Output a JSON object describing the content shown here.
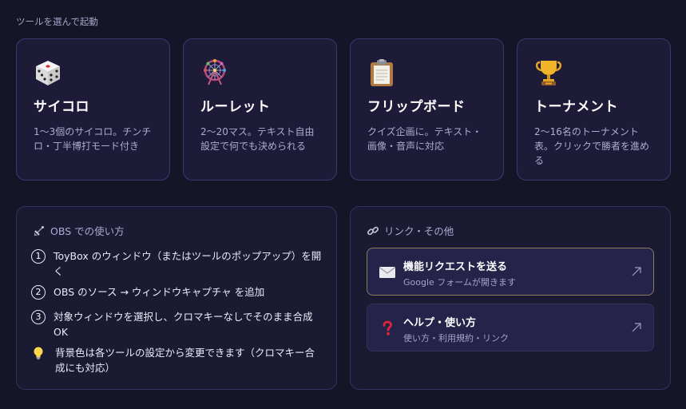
{
  "header": {
    "label": "ツールを選んで起動"
  },
  "tools": [
    {
      "icon": "dice-icon",
      "name": "サイコロ",
      "desc": [
        "1〜3個のサイコロ。チンチ",
        "ロ・丁半博打モード付き"
      ]
    },
    {
      "icon": "ferris-wheel-icon",
      "name": "ルーレット",
      "desc": [
        "2〜20マス。テキスト自由",
        "設定で何でも決められる"
      ]
    },
    {
      "icon": "clipboard-icon",
      "name": "フリップボード",
      "desc": [
        "クイズ企画に。テキスト・",
        "画像・音声に対応"
      ]
    },
    {
      "icon": "trophy-icon",
      "name": "トーナメント",
      "desc": [
        "2〜16名のトーナメント",
        "表。クリックで勝者を進め",
        "る"
      ]
    }
  ],
  "obs": {
    "title": "OBS での使い方",
    "steps": [
      {
        "num": "1",
        "lines": [
          "ToyBox のウィンドウ（またはツールのポップアップ）を開",
          "く"
        ]
      },
      {
        "num": "2",
        "lines": [
          "OBS のソース → ウィンドウキャプチャ を追加"
        ]
      },
      {
        "num": "3",
        "lines": [
          "対象ウィンドウを選択し、クロマキーなしでそのまま合成",
          "OK"
        ]
      }
    ],
    "tip": [
      "背景色は各ツールの設定から変更できます（クロマキー合",
      "成にも対応）"
    ]
  },
  "links": {
    "title": "リンク・その他",
    "items": [
      {
        "icon": "envelope-icon",
        "title": "機能リクエストを送る",
        "sub": "Google フォームが開きます"
      },
      {
        "icon": "question-icon",
        "title": "ヘルプ・使い方",
        "sub": "使い方・利用規約・リンク"
      }
    ]
  }
}
